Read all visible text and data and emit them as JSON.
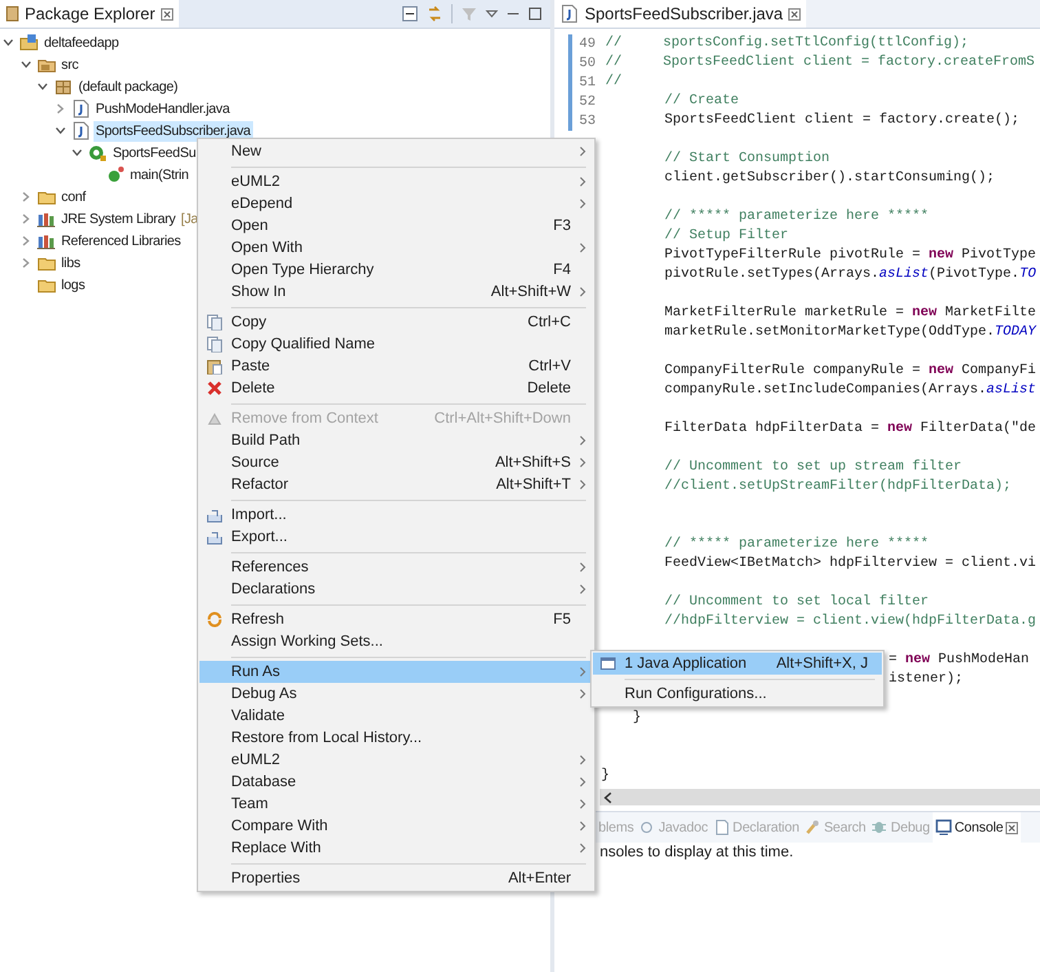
{
  "package_explorer": {
    "title": "Package Explorer",
    "tree": [
      {
        "label": "deltafeedapp",
        "kind": "project",
        "expanded": true,
        "selected": false,
        "children": [
          {
            "label": "src",
            "kind": "source-folder",
            "expanded": true,
            "selected": false,
            "children": [
              {
                "label": "(default package)",
                "kind": "package",
                "expanded": true,
                "selected": false,
                "children": [
                  {
                    "label": "PushModeHandler.java",
                    "kind": "java-file",
                    "expanded": false,
                    "selected": false
                  },
                  {
                    "label": "SportsFeedSubscriber.java",
                    "kind": "java-file",
                    "expanded": true,
                    "selected": true,
                    "children": [
                      {
                        "label": "SportsFeedSu",
                        "kind": "class",
                        "expanded": true,
                        "selected": false,
                        "children": [
                          {
                            "label": "main(Strin",
                            "kind": "method",
                            "selected": false
                          }
                        ]
                      }
                    ]
                  }
                ]
              }
            ]
          },
          {
            "label": "conf",
            "kind": "folder",
            "expanded": false,
            "selected": false
          },
          {
            "label": "JRE System Library",
            "decoration": "[Ja",
            "kind": "library",
            "expanded": false,
            "selected": false
          },
          {
            "label": "Referenced Libraries",
            "kind": "library",
            "expanded": false,
            "selected": false
          },
          {
            "label": "libs",
            "kind": "folder",
            "expanded": false,
            "selected": false
          },
          {
            "label": "logs",
            "kind": "folder",
            "selected": false
          }
        ]
      }
    ]
  },
  "editor": {
    "tab": {
      "title": "SportsFeedSubscriber.java"
    },
    "lines": [
      {
        "number": "49",
        "kind": "commented-out",
        "text": "//     sportsConfig.setTtlConfig(ttlConfig);"
      },
      {
        "number": "50",
        "kind": "commented-out",
        "text": "//     SportsFeedClient client = factory.createFromS"
      },
      {
        "number": "51",
        "kind": "commented-out",
        "text": "//"
      },
      {
        "number": "52",
        "kind": "comment",
        "text": "// Create"
      },
      {
        "number": "53",
        "kind": "statement",
        "text": "SportsFeedClient client = factory.create();"
      },
      {
        "kind": "blank"
      },
      {
        "kind": "comment",
        "text": "// Start Consumption"
      },
      {
        "kind": "statement",
        "text": "client.getSubscriber().startConsuming();"
      },
      {
        "kind": "blank"
      },
      {
        "kind": "comment",
        "text": "// ***** parameterize here *****"
      },
      {
        "kind": "comment",
        "text": "// Setup Filter"
      },
      {
        "kind": "statement",
        "text": "PivotTypeFilterRule pivotRule = **new** PivotType"
      },
      {
        "kind": "statement",
        "text": "pivotRule.setTypes(Arrays.*asList*(PivotType.*TO*"
      },
      {
        "kind": "blank"
      },
      {
        "kind": "statement",
        "text": "MarketFilterRule marketRule = **new** MarketFilte"
      },
      {
        "kind": "statement",
        "text": "marketRule.setMonitorMarketType(OddType.*TODAY*"
      },
      {
        "kind": "blank"
      },
      {
        "kind": "statement",
        "text": "CompanyFilterRule companyRule = **new** CompanyFi"
      },
      {
        "kind": "statement",
        "text": "companyRule.setIncludeCompanies(Arrays.*asList*"
      },
      {
        "kind": "blank"
      },
      {
        "kind": "statement",
        "text": "FilterData hdpFilterData = **new** FilterData(\"de"
      },
      {
        "kind": "blank"
      },
      {
        "kind": "comment",
        "text": "// Uncomment to set up stream filter"
      },
      {
        "kind": "comment",
        "text": "//client.setUpStreamFilter(hdpFilterData);"
      },
      {
        "kind": "blank"
      },
      {
        "kind": "blank"
      },
      {
        "kind": "comment",
        "text": "// ***** parameterize here *****"
      },
      {
        "kind": "statement",
        "text": "FeedView<IBetMatch> hdpFilterview = client.vi"
      },
      {
        "kind": "blank"
      },
      {
        "kind": "comment",
        "text": "// Uncomment to set local filter"
      },
      {
        "kind": "comment",
        "text": "//hdpFilterview = client.view(hdpFilterData.g"
      },
      {
        "kind": "blank"
      },
      {
        "kind": "covered",
        "text": "= **new** PushModeHan"
      },
      {
        "kind": "covered",
        "text": "istener);"
      },
      {
        "kind": "blank"
      },
      {
        "kind": "method-end",
        "text": "}"
      },
      {
        "kind": "blank"
      },
      {
        "kind": "blank"
      },
      {
        "kind": "class-end",
        "text": "}"
      }
    ]
  },
  "context_menu": {
    "items": [
      {
        "kind": "item",
        "label": "New",
        "submenu": true,
        "disabled": false,
        "selected": false
      },
      {
        "kind": "separator"
      },
      {
        "kind": "item",
        "label": "eUML2",
        "submenu": true,
        "disabled": false,
        "selected": false
      },
      {
        "kind": "item",
        "label": "eDepend",
        "submenu": true,
        "disabled": false,
        "selected": false
      },
      {
        "kind": "item",
        "label": "Open",
        "shortcut": "F3",
        "submenu": false,
        "disabled": false,
        "selected": false
      },
      {
        "kind": "item",
        "label": "Open With",
        "submenu": true,
        "disabled": false,
        "selected": false
      },
      {
        "kind": "item",
        "label": "Open Type Hierarchy",
        "shortcut": "F4",
        "submenu": false,
        "disabled": false,
        "selected": false
      },
      {
        "kind": "item",
        "label": "Show In",
        "shortcut": "Alt+Shift+W",
        "submenu": true,
        "disabled": false,
        "selected": false
      },
      {
        "kind": "separator"
      },
      {
        "kind": "copy",
        "label": "Copy",
        "shortcut": "Ctrl+C",
        "submenu": false,
        "disabled": false,
        "selected": false
      },
      {
        "kind": "copy",
        "label": "Copy Qualified Name",
        "submenu": false,
        "disabled": false,
        "selected": false
      },
      {
        "kind": "paste",
        "label": "Paste",
        "shortcut": "Ctrl+V",
        "submenu": false,
        "disabled": false,
        "selected": false
      },
      {
        "kind": "delete",
        "label": "Delete",
        "shortcut": "Delete",
        "submenu": false,
        "disabled": false,
        "selected": false
      },
      {
        "kind": "separator"
      },
      {
        "kind": "context",
        "label": "Remove from Context",
        "shortcut": "Ctrl+Alt+Shift+Down",
        "submenu": false,
        "disabled": true,
        "selected": false
      },
      {
        "kind": "item",
        "label": "Build Path",
        "submenu": true,
        "disabled": false,
        "selected": false
      },
      {
        "kind": "item",
        "label": "Source",
        "shortcut": "Alt+Shift+S",
        "submenu": true,
        "disabled": false,
        "selected": false
      },
      {
        "kind": "item",
        "label": "Refactor",
        "shortcut": "Alt+Shift+T",
        "submenu": true,
        "disabled": false,
        "selected": false
      },
      {
        "kind": "separator"
      },
      {
        "kind": "transfer",
        "label": "Import...",
        "submenu": false,
        "disabled": false,
        "selected": false
      },
      {
        "kind": "transfer",
        "label": "Export...",
        "submenu": false,
        "disabled": false,
        "selected": false
      },
      {
        "kind": "separator"
      },
      {
        "kind": "item",
        "label": "References",
        "submenu": true,
        "disabled": false,
        "selected": false
      },
      {
        "kind": "item",
        "label": "Declarations",
        "submenu": true,
        "disabled": false,
        "selected": false
      },
      {
        "kind": "separator"
      },
      {
        "kind": "refresh",
        "label": "Refresh",
        "shortcut": "F5",
        "submenu": false,
        "disabled": false,
        "selected": false
      },
      {
        "kind": "item",
        "label": "Assign Working Sets...",
        "submenu": false,
        "disabled": false,
        "selected": false
      },
      {
        "kind": "separator"
      },
      {
        "kind": "item",
        "label": "Run As",
        "submenu": true,
        "disabled": false,
        "selected": true
      },
      {
        "kind": "item",
        "label": "Debug As",
        "submenu": true,
        "disabled": false,
        "selected": false
      },
      {
        "kind": "item",
        "label": "Validate",
        "submenu": false,
        "disabled": false,
        "selected": false
      },
      {
        "kind": "item",
        "label": "Restore from Local History...",
        "submenu": false,
        "disabled": false,
        "selected": false
      },
      {
        "kind": "item",
        "label": "eUML2",
        "submenu": true,
        "disabled": false,
        "selected": false
      },
      {
        "kind": "item",
        "label": "Database",
        "submenu": true,
        "disabled": false,
        "selected": false
      },
      {
        "kind": "item",
        "label": "Team",
        "submenu": true,
        "disabled": false,
        "selected": false
      },
      {
        "kind": "item",
        "label": "Compare With",
        "submenu": true,
        "disabled": false,
        "selected": false
      },
      {
        "kind": "item",
        "label": "Replace With",
        "submenu": true,
        "disabled": false,
        "selected": false
      },
      {
        "kind": "separator"
      },
      {
        "kind": "item",
        "label": "Properties",
        "shortcut": "Alt+Enter",
        "submenu": false,
        "disabled": false,
        "selected": false
      }
    ]
  },
  "submenu": {
    "items": [
      {
        "kind": "launch",
        "label": "1 Java Application",
        "shortcut": "Alt+Shift+X, J",
        "selected": true
      },
      {
        "kind": "separator"
      },
      {
        "kind": "item",
        "label": "Run Configurations...",
        "selected": false
      }
    ]
  },
  "bottom_panel": {
    "tabs": [
      {
        "kind": "problems",
        "label": "blems",
        "selected": false
      },
      {
        "kind": "javadoc",
        "label": "Javadoc",
        "selected": false
      },
      {
        "kind": "declaration",
        "label": "Declaration",
        "selected": false
      },
      {
        "kind": "search",
        "label": "Search",
        "selected": false
      },
      {
        "kind": "debug",
        "label": "Debug",
        "selected": false
      },
      {
        "kind": "console",
        "label": "Console",
        "selected": true
      }
    ],
    "message": "nsoles to display at this time."
  }
}
